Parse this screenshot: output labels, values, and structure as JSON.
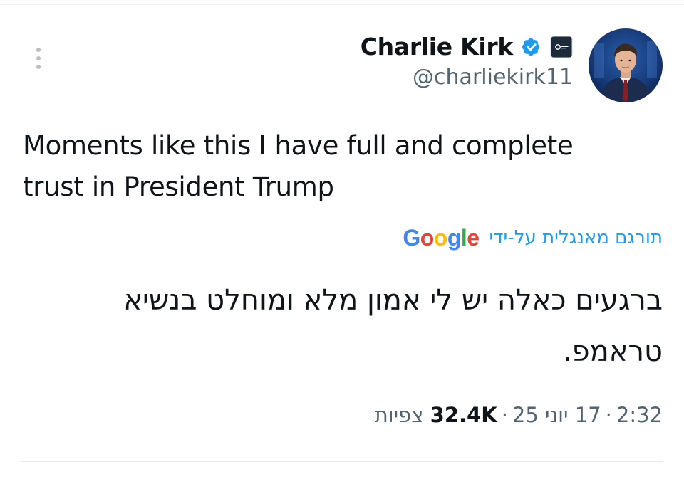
{
  "author": {
    "display_name": "Charlie Kirk",
    "handle": "@charliekirk11",
    "verified": true,
    "avatar_icon": "profile-photo-man-in-suit",
    "affiliate_icon": "organization-badge-icon"
  },
  "tweet": {
    "text": "Moments like this I have full and complete trust in President Trump"
  },
  "translation": {
    "label": "תורגם מאנגלית על-ידי",
    "provider": "Google",
    "text": "ברגעים כאלה יש לי אמון מלא ומוחלט בנשיא טראמפ."
  },
  "meta": {
    "time": "2:32",
    "separator": "·",
    "date": "17 יוני 25",
    "views_count": "32.4K",
    "views_label": "צפיות"
  },
  "colors": {
    "verified_blue": "#1d9bf0",
    "text_primary": "#0f1419",
    "text_secondary": "#536471"
  },
  "icons": {
    "more": "more-vertical-icon",
    "verified": "verified-badge-icon"
  }
}
